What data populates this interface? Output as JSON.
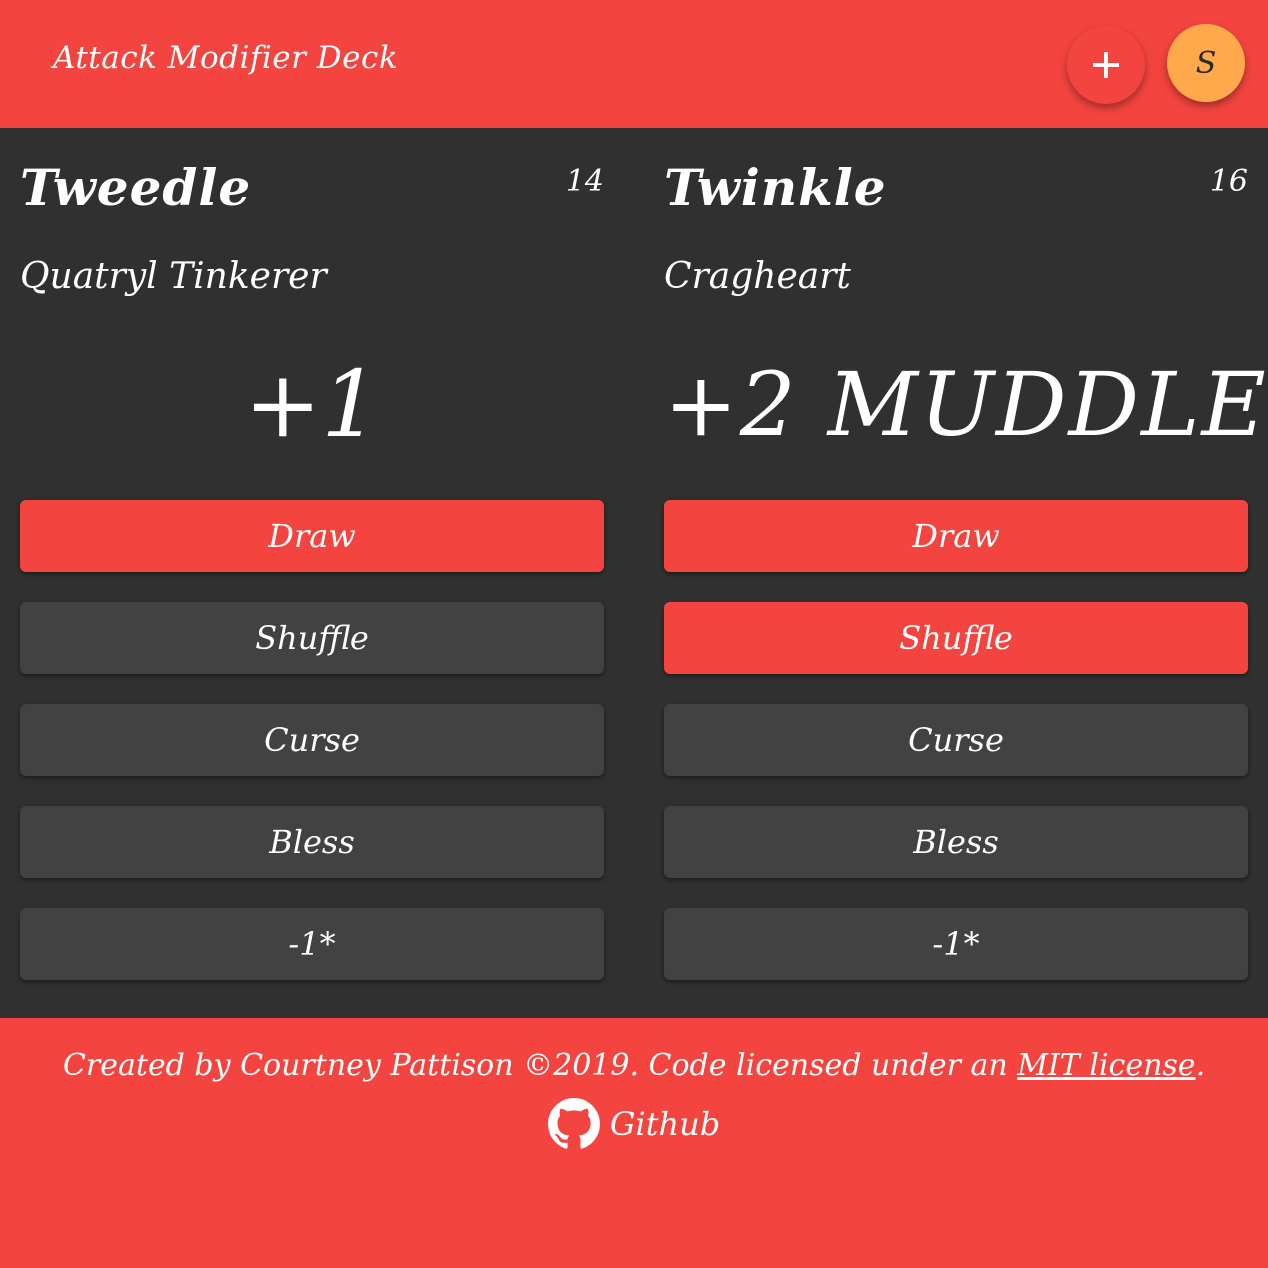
{
  "header": {
    "title": "Attack Modifier Deck",
    "add_icon": "plus-icon",
    "avatar_label": "S",
    "accent_color": "#f3443f",
    "avatar_color": "#ffa94c"
  },
  "decks": [
    {
      "name": "Tweedle",
      "count": "14",
      "class": "Quatryl Tinkerer",
      "drawn_card": "+1",
      "buttons": {
        "draw": "Draw",
        "shuffle": "Shuffle",
        "curse": "Curse",
        "bless": "Bless",
        "minus": "-1*"
      },
      "active": [
        "draw"
      ]
    },
    {
      "name": "Twinkle",
      "count": "16",
      "class": "Cragheart",
      "drawn_card": "+2 MUDDLE",
      "buttons": {
        "draw": "Draw",
        "shuffle": "Shuffle",
        "curse": "Curse",
        "bless": "Bless",
        "minus": "-1*"
      },
      "active": [
        "draw",
        "shuffle"
      ]
    }
  ],
  "footer": {
    "credit_prefix": "Created by Courtney Pattison ©2019. Code licensed under an ",
    "license_link": "MIT license",
    "credit_suffix": ".",
    "github_label": "Github",
    "github_icon": "github-icon"
  },
  "colors": {
    "background": "#303030",
    "button": "#424242",
    "button_active": "#f3443f"
  }
}
